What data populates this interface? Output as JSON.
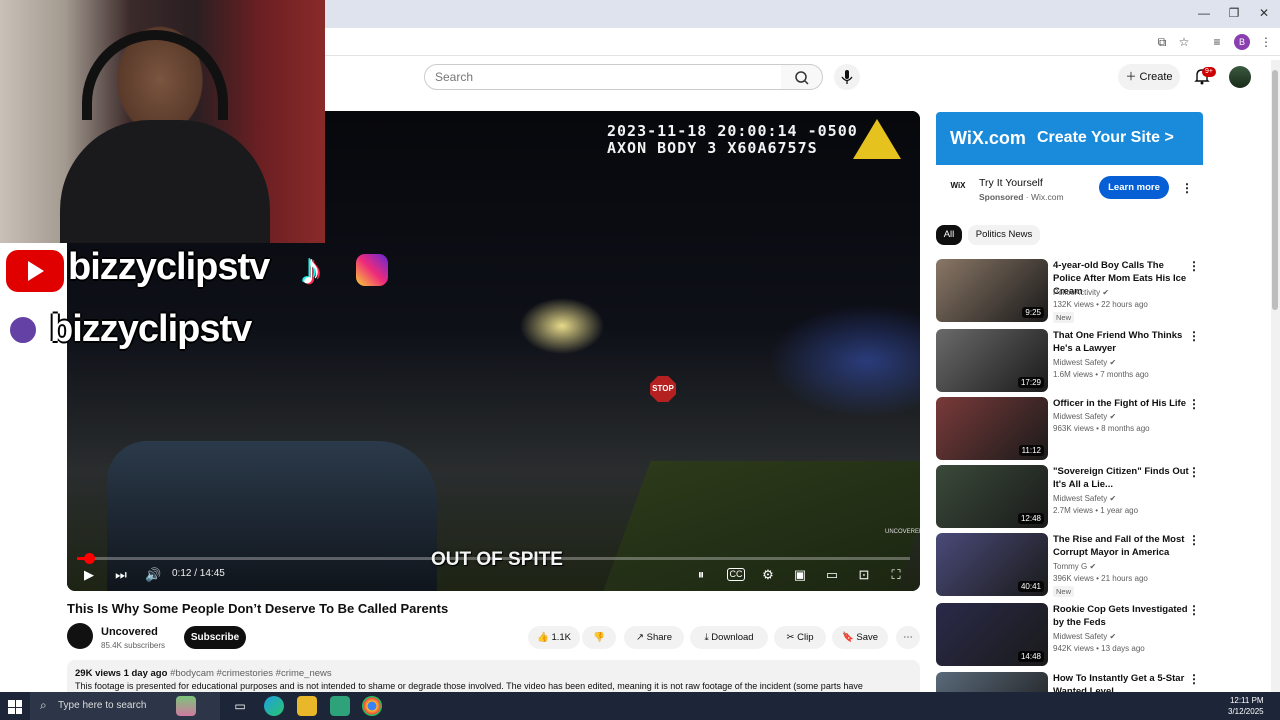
{
  "browser": {
    "window_controls": {
      "minimize": "—",
      "restore": "❐",
      "close": "✕"
    },
    "profile_letter": "B"
  },
  "header": {
    "search_placeholder": "Search",
    "create_label": "Create",
    "notifications_badge": "9+"
  },
  "video": {
    "timestamp_line1": "2023-11-18 20:00:14 -0500",
    "timestamp_line2": "AXON BODY 3 X60A6757S",
    "caption": "OUT OF SPITE",
    "stop_sign": "STOP",
    "watermark": "UNCOVERED",
    "time_display": "0:12 / 14:45",
    "progress": 0.014,
    "title": "This Is Why Some People Don’t Deserve To Be Called Parents"
  },
  "overlay": {
    "handle1": "bizzyclipstv",
    "handle2": "bizzyclipstv"
  },
  "channel": {
    "name": "Uncovered",
    "subscribers": "85.4K subscribers",
    "subscribe_label": "Subscribe"
  },
  "actions": {
    "likes": "1.1K",
    "share": "Share",
    "download": "Download",
    "clip": "Clip",
    "save": "Save"
  },
  "description": {
    "meta": "29K views  1 day ago",
    "tags": "#bodycam #crimestories #crime_news",
    "text": "This footage is presented for educational purposes and is not intended to shame or degrade those involved. The video has been edited, meaning it is not raw footage of the incident (some parts have"
  },
  "ad": {
    "banner_brand": "WiX.com",
    "banner_cta": "Create Your Site >",
    "logo": "WiX",
    "title": "Try It Yourself",
    "sponsored": "Sponsored",
    "domain": "Wix.com",
    "learn_more": "Learn more"
  },
  "chips": [
    "All",
    "Politics News"
  ],
  "recommendations": [
    {
      "title": "4-year-old Boy Calls The Police After Mom Eats His Ice Cream",
      "channel": "PoliceActivity",
      "meta": "132K views • 22 hours ago",
      "duration": "9:25",
      "badge": "New",
      "thumb_color": "#8a7766"
    },
    {
      "title": "That One Friend Who Thinks He's a Lawyer",
      "channel": "Midwest Safety",
      "meta": "1.6M views • 7 months ago",
      "duration": "17:29",
      "badge": "",
      "thumb_color": "#6a6a6a"
    },
    {
      "title": "Officer in the Fight of His Life",
      "channel": "Midwest Safety",
      "meta": "963K views • 8 months ago",
      "duration": "11:12",
      "badge": "",
      "thumb_color": "#7a3a3a"
    },
    {
      "title": "\"Sovereign Citizen\" Finds Out It's All a Lie...",
      "channel": "Midwest Safety",
      "meta": "2.7M views • 1 year ago",
      "duration": "12:48",
      "badge": "",
      "thumb_color": "#3a4a3a"
    },
    {
      "title": "The Rise and Fall of the Most Corrupt Mayor in America",
      "channel": "Tommy G",
      "meta": "396K views • 21 hours ago",
      "duration": "40:41",
      "badge": "New",
      "thumb_color": "#4a4a7a"
    },
    {
      "title": "Rookie Cop Gets Investigated by the Feds",
      "channel": "Midwest Safety",
      "meta": "942K views • 13 days ago",
      "duration": "14:48",
      "badge": "",
      "thumb_color": "#2a2a4a"
    },
    {
      "title": "How To Instantly Get a 5-Star Wanted Level",
      "channel": "",
      "meta": "",
      "duration": "",
      "badge": "",
      "thumb_color": "#5a6a7a"
    }
  ],
  "taskbar": {
    "search_placeholder": "Type here to search",
    "time": "12:11 PM",
    "date": "3/12/2025"
  },
  "colors": {
    "yt_red": "#ff0000",
    "accent_blue": "#065fd4",
    "taskbar": "#1c2638"
  }
}
